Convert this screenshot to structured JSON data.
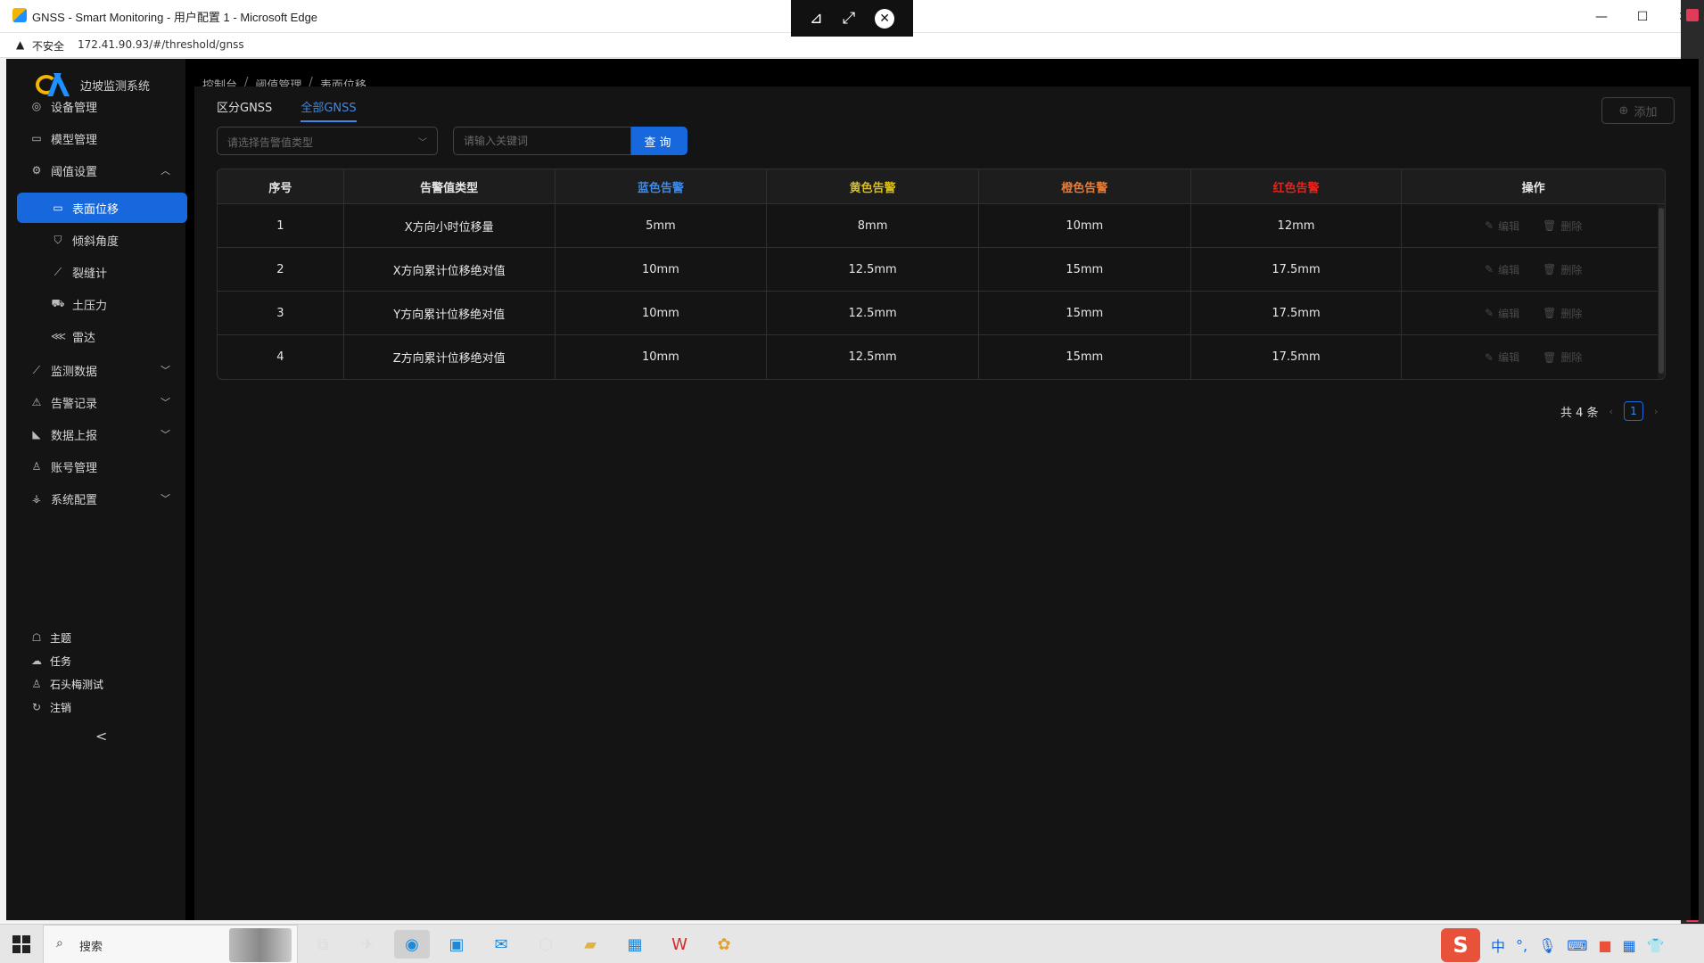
{
  "browser": {
    "window_title": "GNSS - Smart Monitoring - 用户配置 1 - Microsoft Edge",
    "security_label": "不安全",
    "url": "172.41.90.93/#/threshold/gnss",
    "controls": {
      "minimize": "—",
      "maximize": "☐",
      "close": "✕"
    },
    "remote_bar": {
      "pin": "⊿",
      "fit": "⤢",
      "close": "✕"
    }
  },
  "sidebar": {
    "brand": "边坡监测系统",
    "items": [
      {
        "label": "设备管理",
        "icon": "location-icon"
      },
      {
        "label": "模型管理",
        "icon": "laptop-icon"
      },
      {
        "label": "阈值设置",
        "icon": "gear-icon",
        "expanded": true
      },
      {
        "label": "表面位移",
        "icon": "desktop-icon",
        "active": true
      },
      {
        "label": "倾斜角度",
        "icon": "shield-icon"
      },
      {
        "label": "裂缝计",
        "icon": "stock-icon"
      },
      {
        "label": "土压力",
        "icon": "truck-icon"
      },
      {
        "label": "雷达",
        "icon": "share-icon"
      },
      {
        "label": "监测数据",
        "icon": "line-chart-icon"
      },
      {
        "label": "告警记录",
        "icon": "alert-icon"
      },
      {
        "label": "数据上报",
        "icon": "area-chart-icon"
      },
      {
        "label": "账号管理",
        "icon": "team-icon"
      },
      {
        "label": "系统配置",
        "icon": "setting-icon"
      }
    ],
    "bottom": [
      {
        "label": "主题",
        "icon": "skin-icon"
      },
      {
        "label": "任务",
        "icon": "cloud-upload-icon"
      },
      {
        "label": "石头梅测试",
        "icon": "user-icon"
      },
      {
        "label": "注销",
        "icon": "logout-icon"
      }
    ],
    "collapse_glyph": "<"
  },
  "breadcrumb": [
    "控制台",
    "阈值管理",
    "表面位移"
  ],
  "breadcrumb_sep": "/",
  "tabs": [
    {
      "label": "区分GNSS",
      "active": false
    },
    {
      "label": "全部GNSS",
      "active": true
    }
  ],
  "add_button": "添加",
  "filter": {
    "select_placeholder": "请选择告警值类型",
    "search_placeholder": "请输入关键词",
    "query_label": "查询"
  },
  "colors": {
    "blue_alert": "#3c89e8",
    "yellow_alert": "#d8bd14",
    "orange_alert": "#e87a31",
    "red_alert": "#e8211c",
    "primary": "#1668dc"
  },
  "table": {
    "headers": [
      "序号",
      "告警值类型",
      "蓝色告警",
      "黄色告警",
      "橙色告警",
      "红色告警",
      "操作"
    ],
    "rows": [
      {
        "index": "1",
        "type": "X方向小时位移量",
        "blue": "5mm",
        "yellow": "8mm",
        "orange": "10mm",
        "red": "12mm"
      },
      {
        "index": "2",
        "type": "X方向累计位移绝对值",
        "blue": "10mm",
        "yellow": "12.5mm",
        "orange": "15mm",
        "red": "17.5mm"
      },
      {
        "index": "3",
        "type": "Y方向累计位移绝对值",
        "blue": "10mm",
        "yellow": "12.5mm",
        "orange": "15mm",
        "red": "17.5mm"
      },
      {
        "index": "4",
        "type": "Z方向累计位移绝对值",
        "blue": "10mm",
        "yellow": "12.5mm",
        "orange": "15mm",
        "red": "17.5mm"
      }
    ],
    "edit_label": "编辑",
    "delete_label": "删除"
  },
  "pagination": {
    "total": "共 4 条",
    "current_page": "1"
  },
  "taskbar": {
    "search_label": "搜索",
    "tray_ime": "中",
    "tray_punct": "°,"
  }
}
